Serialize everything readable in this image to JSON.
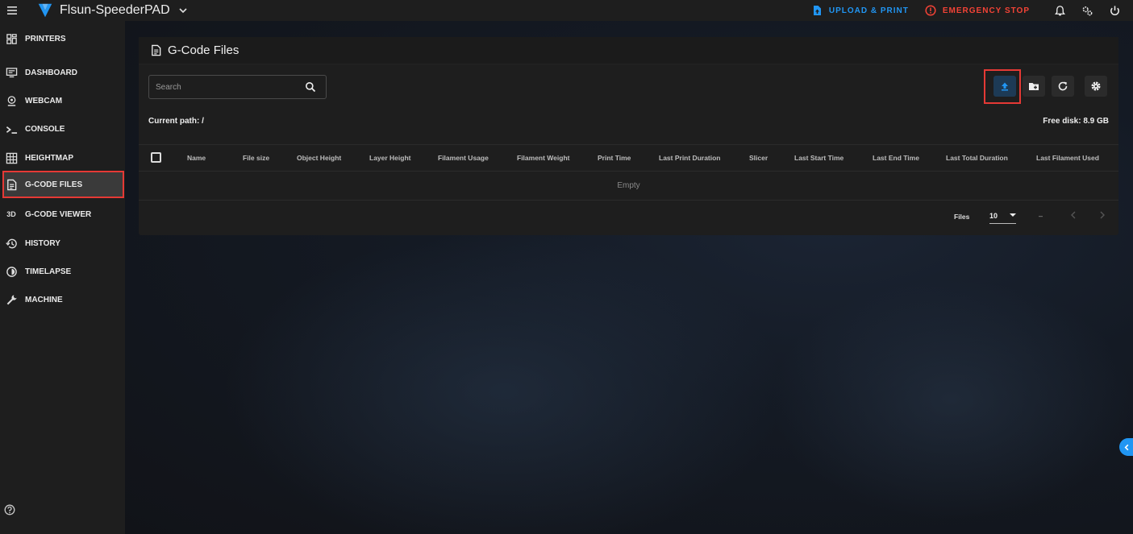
{
  "app": {
    "printer_name": "Flsun-SpeederPAD",
    "upload_print_label": "UPLOAD & PRINT",
    "emergency_stop_label": "EMERGENCY STOP",
    "colors": {
      "accent": "#2196f3",
      "danger": "#f44336",
      "highlight": "#e53935"
    }
  },
  "sidebar": {
    "items": [
      {
        "label": "PRINTERS",
        "icon": "printers-grid-icon"
      },
      {
        "label": "DASHBOARD",
        "icon": "dashboard-icon"
      },
      {
        "label": "WEBCAM",
        "icon": "webcam-icon"
      },
      {
        "label": "CONSOLE",
        "icon": "console-icon"
      },
      {
        "label": "HEIGHTMAP",
        "icon": "heightmap-icon"
      },
      {
        "label": "G-CODE FILES",
        "icon": "file-document-icon",
        "active": true
      },
      {
        "label": "G-CODE VIEWER",
        "icon": "3d-icon",
        "icon_text": "3D"
      },
      {
        "label": "HISTORY",
        "icon": "history-icon"
      },
      {
        "label": "TIMELAPSE",
        "icon": "timelapse-icon"
      },
      {
        "label": "MACHINE",
        "icon": "wrench-icon"
      }
    ]
  },
  "files_panel": {
    "title": "G-Code Files",
    "search_placeholder": "Search",
    "current_path_label": "Current path: /",
    "free_disk_label": "Free disk: 8.9 GB",
    "columns": [
      "Name",
      "File size",
      "Object Height",
      "Layer Height",
      "Filament Usage",
      "Filament Weight",
      "Print Time",
      "Last Print Duration",
      "Slicer",
      "Last Start Time",
      "Last End Time",
      "Last Total Duration",
      "Last Filament Used"
    ],
    "empty_text": "Empty",
    "footer": {
      "files_label": "Files",
      "per_page": "10",
      "page_range": "–"
    }
  }
}
